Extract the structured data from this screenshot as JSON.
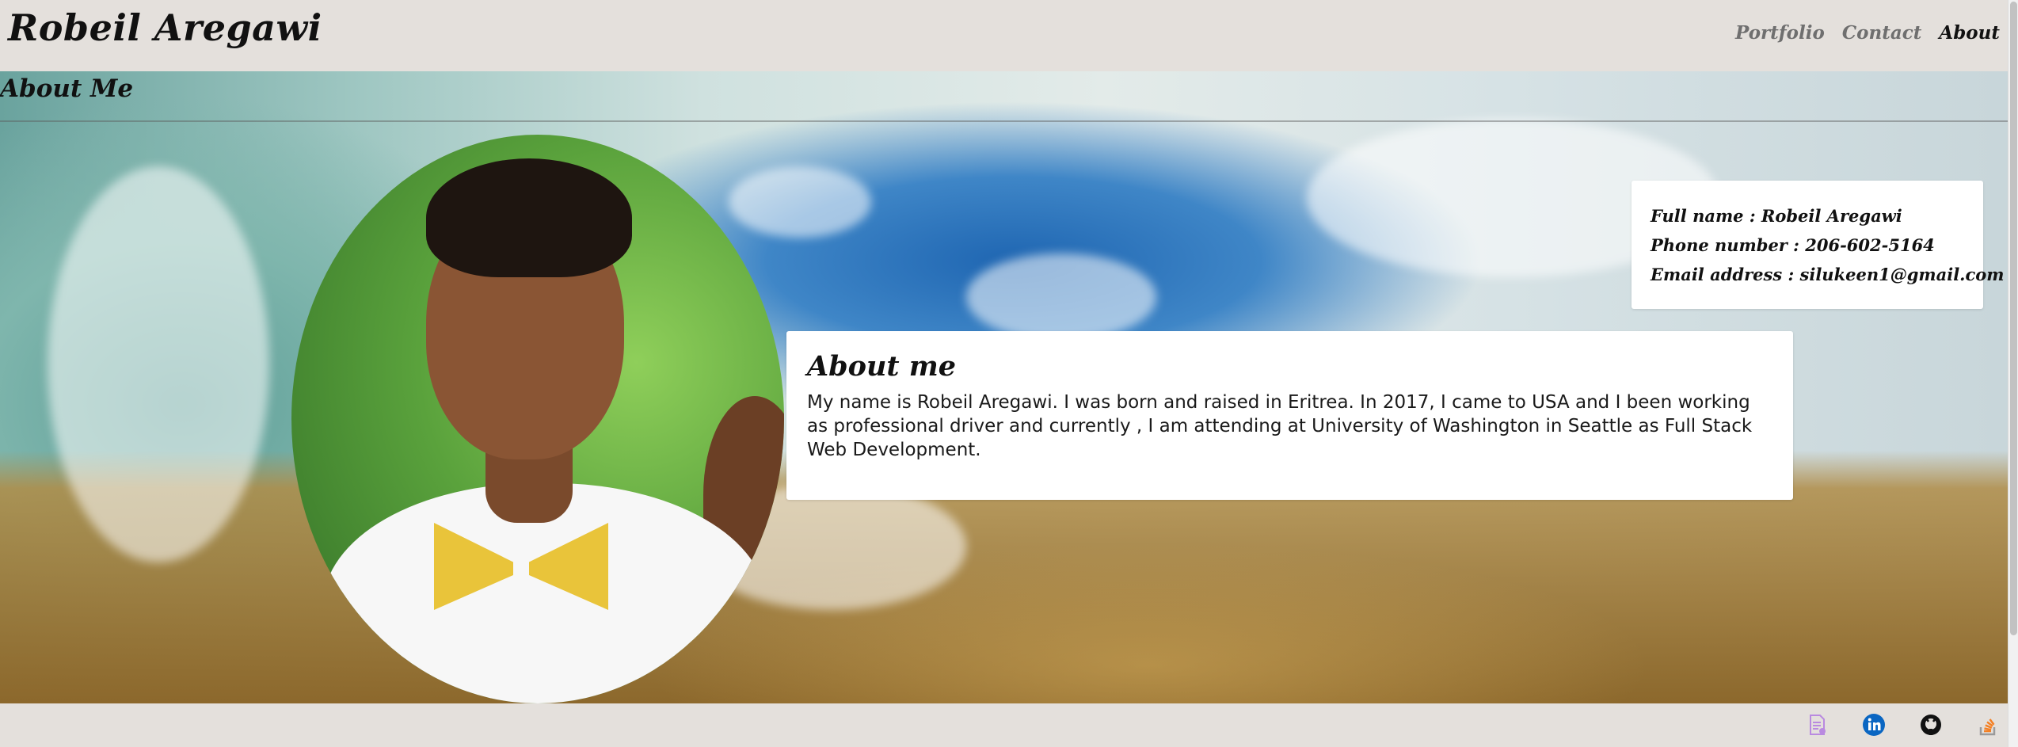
{
  "header": {
    "brand": "Robeil Aregawi",
    "nav": [
      {
        "label": "Portfolio"
      },
      {
        "label": "Contact"
      },
      {
        "label": "About"
      }
    ]
  },
  "hero": {
    "title": "About Me"
  },
  "info": {
    "full_name": "Full name : Robeil Aregawi",
    "phone": "Phone number : 206-602-5164",
    "email": "Email address : silukeen1@gmail.com"
  },
  "about": {
    "heading": "About me",
    "text": "My name is Robeil Aregawi. I was born and raised in Eritrea. In 2017, I came to USA and I been working as professional driver and currently , I am attending at University of Washington in Seattle as Full Stack Web Development."
  },
  "footer": {
    "icons": [
      "resume-icon",
      "linkedin-icon",
      "github-icon",
      "stackoverflow-icon"
    ]
  },
  "colors": {
    "header_bg": "#e4e0dc",
    "nav_inactive": "#6f6f6f",
    "nav_active": "#111111",
    "linkedin_blue": "#0a66c2"
  }
}
